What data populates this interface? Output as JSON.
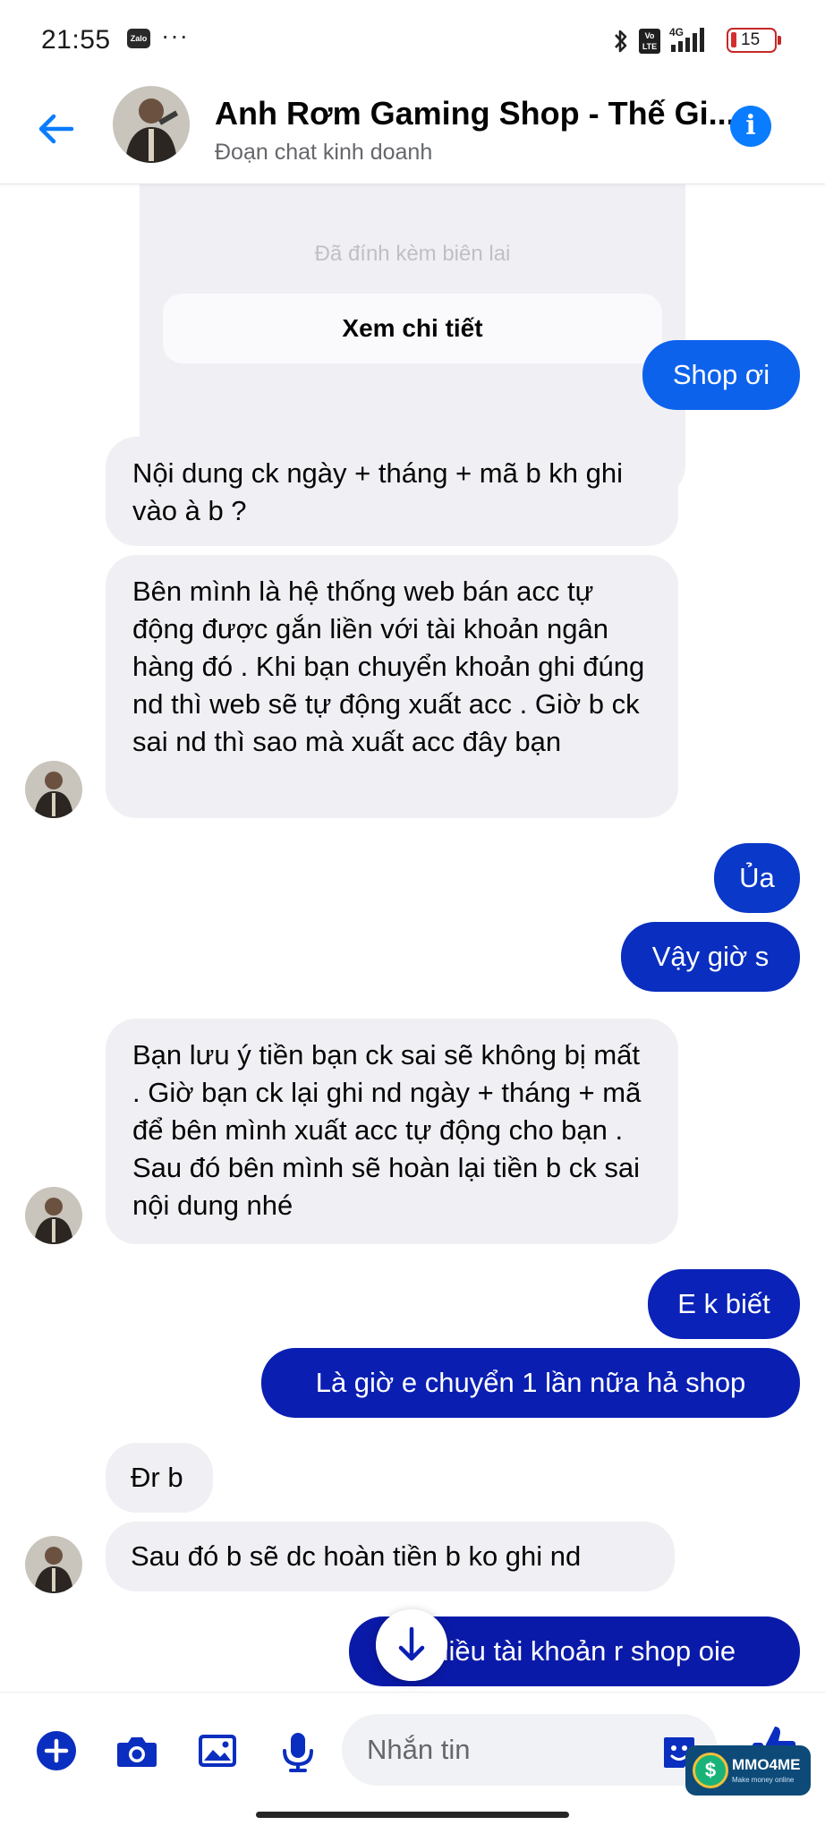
{
  "status_bar": {
    "time": "21:55",
    "app_badge": "Zalo",
    "more": "···",
    "network": "4G",
    "volte": "Vo LTE",
    "battery_level": "15"
  },
  "header": {
    "title": "Anh Rơm Gaming Shop - Thế Gi...",
    "subtitle": "Đoạn chat kinh doanh",
    "info_glyph": "i"
  },
  "card": {
    "faded_text": "Đã đính kèm biên lai",
    "button_label": "Xem chi tiết"
  },
  "messages": [
    {
      "from": "me",
      "text": "Shop ơi"
    },
    {
      "from": "shop",
      "text": "Nội dung ck ngày + tháng + mã b kh ghi vào à b ?"
    },
    {
      "from": "shop",
      "text": "Bên mình là hệ thống web bán acc tự động được gắn liền với tài khoản ngân hàng đó . Khi bạn chuyển khoản ghi đúng nd thì web sẽ tự động xuất acc . Giờ b ck sai nd thì sao mà xuất acc đây bạn"
    },
    {
      "from": "me",
      "text": "Ủa"
    },
    {
      "from": "me",
      "text": "Vậy giờ s"
    },
    {
      "from": "shop",
      "text": "Bạn lưu ý tiền bạn ck sai sẽ không bị mất . Giờ bạn ck lại ghi nd ngày + tháng + mã để bên mình xuất acc tự động cho bạn . Sau đó bên mình sẽ hoàn lại tiền b ck sai nội dung nhé"
    },
    {
      "from": "me",
      "text": "E k biết"
    },
    {
      "from": "me",
      "text": "Là giờ e chuyển 1 lần nữa hả shop"
    },
    {
      "from": "shop",
      "text": "Đr b"
    },
    {
      "from": "shop",
      "text": "Sau đó b sẽ dc hoàn tiền b ko ghi nd"
    },
    {
      "from": "me",
      "text": "Nhiều tài khoản r shop oie"
    }
  ],
  "composer": {
    "placeholder": "Nhắn tin"
  },
  "watermark": {
    "name": "MMO4ME",
    "tagline": "Make money online",
    "coin": "$"
  },
  "colors": {
    "accent": "#0a7cff",
    "bubble_out_top": "#0e66ee",
    "bubble_out_bottom": "#0b1aa8",
    "bubble_in": "#f0f0f4"
  }
}
